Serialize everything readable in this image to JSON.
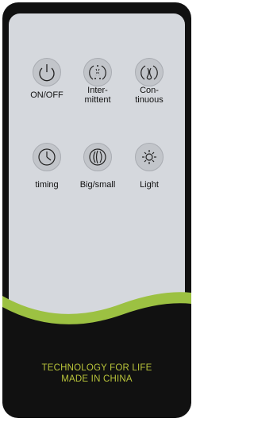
{
  "buttons": [
    {
      "id": "on-off",
      "label": "ON/OFF",
      "icon": "power-icon"
    },
    {
      "id": "intermittent",
      "label": "Inter-\nmittent",
      "icon": "intermittent-icon"
    },
    {
      "id": "continuous",
      "label": "Con-\ntinuous",
      "icon": "continuous-icon"
    },
    {
      "id": "timing",
      "label": "timing",
      "icon": "clock-icon"
    },
    {
      "id": "big-small",
      "label": "Big/small",
      "icon": "mist-size-icon"
    },
    {
      "id": "light",
      "label": "Light",
      "icon": "light-icon"
    }
  ],
  "footer": {
    "line1": "TECHNOLOGY FOR LIFE",
    "line2": "MADE IN CHINA"
  },
  "colors": {
    "body": "#111111",
    "face": "#d5d8dd",
    "accent": "#9cc142",
    "text": "#b9c43a"
  }
}
